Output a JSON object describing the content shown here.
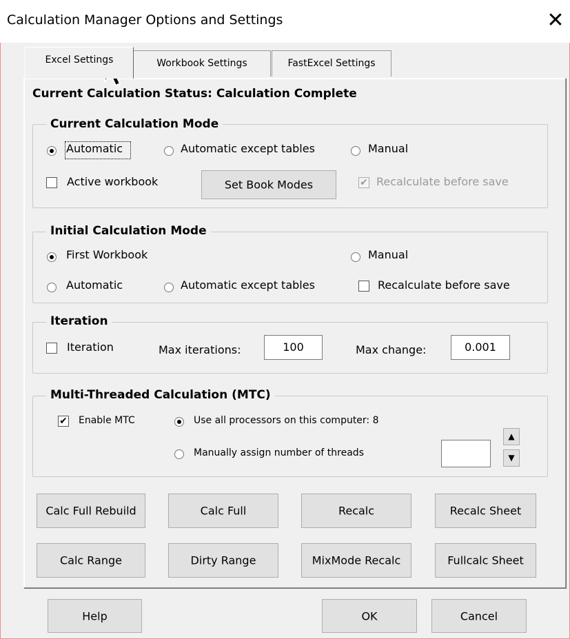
{
  "window": {
    "title": "Calculation Manager Options and Settings",
    "close_glyph": "✕"
  },
  "tabs": [
    {
      "label": "Excel Settings",
      "active": true
    },
    {
      "label": "Workbook Settings",
      "active": false
    },
    {
      "label": "FastExcel Settings",
      "active": false
    }
  ],
  "status": {
    "text": "Current Calculation Status:  Calculation Complete"
  },
  "current_mode": {
    "legend": "Current Calculation Mode",
    "radio_automatic": "Automatic",
    "radio_auto_except": "Automatic except tables",
    "radio_manual": "Manual",
    "selected": "Automatic",
    "check_active_workbook": "Active workbook",
    "active_workbook_checked": false,
    "set_book_modes": "Set Book Modes",
    "check_recalc_before_save": "Recalculate before save",
    "recalc_before_save_checked": true,
    "recalc_before_save_disabled": true
  },
  "initial_mode": {
    "legend": "Initial Calculation Mode",
    "radio_first_workbook": "First Workbook",
    "radio_manual": "Manual",
    "radio_automatic": "Automatic",
    "radio_auto_except": "Automatic except tables",
    "selected": "First Workbook",
    "check_recalc_before_save": "Recalculate before save",
    "recalc_before_save_checked": false
  },
  "iteration": {
    "legend": "Iteration",
    "check_iteration": "Iteration",
    "iteration_checked": false,
    "max_iterations_label": "Max iterations:",
    "max_iterations_value": "100",
    "max_change_label": "Max change:",
    "max_change_value": "0.001"
  },
  "mtc": {
    "legend": "Multi-Threaded Calculation (MTC)",
    "check_enable": "Enable MTC",
    "enable_checked": true,
    "radio_all_processors": "Use all processors on this computer: 8",
    "radio_manual_threads": "Manually assign number of threads",
    "selected": "all",
    "threads_value": "",
    "spin_up": "▲",
    "spin_down": "▼"
  },
  "calc_buttons": {
    "calc_full_rebuild": "Calc Full Rebuild",
    "calc_full": "Calc Full",
    "recalc": "Recalc",
    "recalc_sheet": "Recalc Sheet",
    "calc_range": "Calc Range",
    "dirty_range": "Dirty Range",
    "mixmode_recalc": "MixMode Recalc",
    "fullcalc_sheet": "Fullcalc Sheet"
  },
  "footer": {
    "help": "Help",
    "ok": "OK",
    "cancel": "Cancel"
  },
  "icons": {
    "close": "close-icon",
    "cursor": "mouse-pointer-icon"
  }
}
